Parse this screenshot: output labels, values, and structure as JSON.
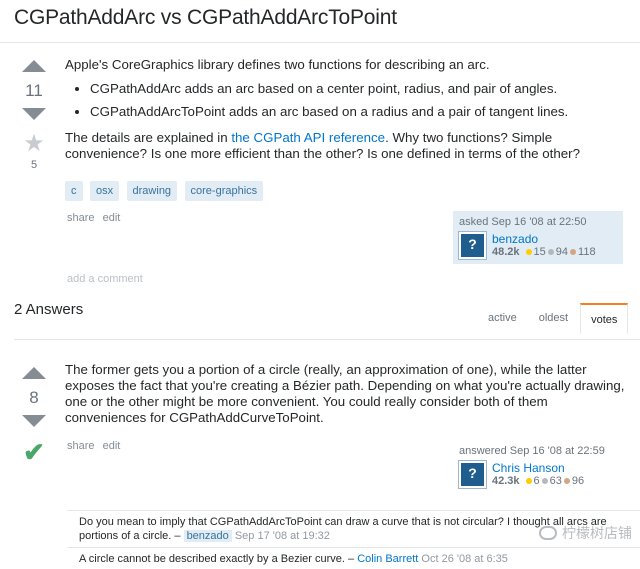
{
  "question": {
    "title": "CGPathAddArc vs CGPathAddArcToPoint",
    "votes": "11",
    "favorites": "5",
    "intro": "Apple's CoreGraphics library defines two functions for describing an arc.",
    "bullets": [
      "CGPathAddArc adds an arc based on a center point, radius, and pair of angles.",
      "CGPathAddArcToPoint adds an arc based on a radius and a pair of tangent lines."
    ],
    "details_before_link": "The details are explained in ",
    "details_link": "the CGPath API reference",
    "details_after_link": ". Why two functions? Simple convenience? Is one more efficient than the other? Is one defined in terms of the other?",
    "tags": [
      "c",
      "osx",
      "drawing",
      "core-graphics"
    ],
    "menu": {
      "share": "share",
      "edit": "edit"
    },
    "asked": "asked Sep 16 '08 at 22:50",
    "user": {
      "name": "benzado",
      "rep": "48.2k",
      "gold": "15",
      "silver": "94",
      "bronze": "118"
    },
    "add_comment": "add a comment"
  },
  "answers_header": "2 Answers",
  "sort_tabs": [
    "active",
    "oldest",
    "votes"
  ],
  "answer": {
    "votes": "8",
    "text": "The former gets you a portion of a circle (really, an approximation of one), while the latter exposes the fact that you're creating a Bézier path. Depending on what you're actually drawing, one or the other might be more convenient. You could really consider both of them conveniences for CGPathAddCurveToPoint.",
    "menu": {
      "share": "share",
      "edit": "edit"
    },
    "answered": "answered Sep 16 '08 at 22:59",
    "user": {
      "name": "Chris Hanson",
      "rep": "42.3k",
      "gold": "6",
      "silver": "63",
      "bronze": "96"
    },
    "comments": [
      {
        "text": "Do you mean to imply that CGPathAddArcToPoint can draw a curve that is not circular? I thought all arcs are portions of a circle. – ",
        "user": "benzado",
        "date": "Sep 17 '08 at 19:32"
      },
      {
        "text": "A circle cannot be described exactly by a Bezier curve. – ",
        "user": "Colin Barrett",
        "date": "Oct 26 '08 at 6:35"
      }
    ]
  },
  "watermark": "柠檬树店铺",
  "colors": {
    "link": "#0077cc",
    "tag_bg": "#e1ecf4",
    "accepted": "#48a868",
    "active_tab": "#f48024"
  }
}
